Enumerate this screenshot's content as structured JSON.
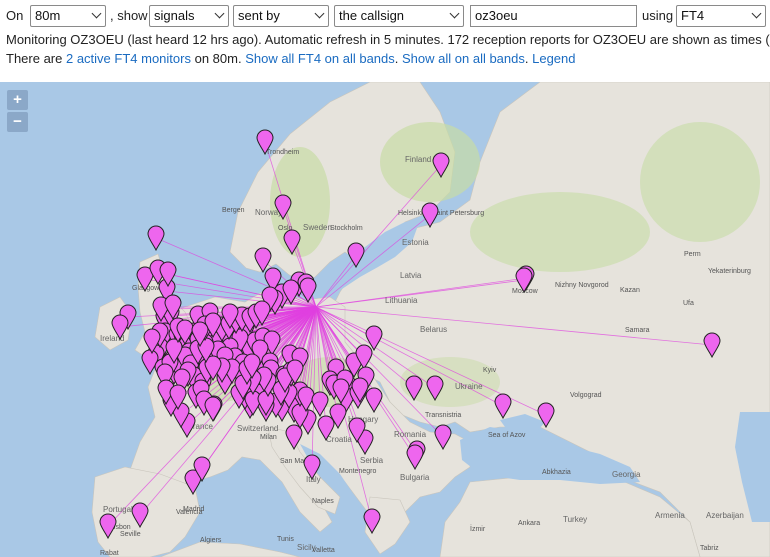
{
  "controls": {
    "on_label": "On",
    "band": "80m",
    "show_label": ", show",
    "show": "signals",
    "direction": "sent by",
    "target": "the callsign",
    "callsign": "oz3oeu",
    "using_label": "using",
    "mode": "FT4"
  },
  "info": {
    "line1": "Monitoring OZ3OEU (last heard 12 hrs ago). Automatic refresh in 5 minutes. 172 reception reports for OZ3OEU are shown as times (",
    "line2_pre": "There are ",
    "active_monitors_link": "2 active FT4 monitors",
    "line2_mid": " on 80m. ",
    "show_all_ft4_link": "Show all FT4 on all bands",
    "dot1": ". ",
    "show_all_link": "Show all on all bands",
    "dot2": ". ",
    "legend_link": "Legend"
  },
  "map": {
    "zoom_in": "+",
    "zoom_out": "−",
    "cities": {
      "trondheim": "Trondheim",
      "finland": "Finland",
      "bergen": "Bergen",
      "norway": "Norway",
      "helsinki": "Helsinki",
      "saint_petersburg": "Saint Petersburg",
      "oslo": "Oslo",
      "sweden": "Sweden",
      "stockholm": "Stockholm",
      "estonia": "Estonia",
      "perm": "Perm",
      "latvia": "Latvia",
      "yekaterinburg": "Yekaterinburg",
      "nizhny": "Nizhny Novgorod",
      "kazan": "Kazan",
      "moscow": "Moscow",
      "lithuania": "Lithuania",
      "ufa": "Ufa",
      "glasgow": "Glasgow",
      "belarus": "Belarus",
      "samara": "Samara",
      "ireland": "Ireland",
      "kyiv": "Kyiv",
      "ukraine": "Ukraine",
      "volgograd": "Volgograd",
      "transnistria": "Transnistria",
      "sea_of_azov": "Sea of Azov",
      "france": "France",
      "switzerland": "Switzerland",
      "milan": "Milan",
      "hungary": "Hungary",
      "croatia": "Croatia",
      "romania": "Romania",
      "san_marino": "San Marino",
      "serbia": "Serbia",
      "abkhazia": "Abkhazia",
      "georgia": "Georgia",
      "montenegro": "Montenegro",
      "bulgaria": "Bulgaria",
      "italy": "Italy",
      "naples": "Naples",
      "portugal": "Portugal",
      "madrid": "Madrid",
      "lisbon": "Lisbon",
      "valencia": "Valencia",
      "ankara": "Ankara",
      "turkey": "Turkey",
      "seville": "Seville",
      "izmir": "İzmir",
      "armenia": "Armenia",
      "azerbaijan": "Azerbaijan",
      "tabriz": "Tabriz",
      "algiers": "Algiers",
      "tunis": "Tunis",
      "sicily": "Sicily",
      "valletta": "Valletta",
      "rabat": "Rabat"
    },
    "marker_count_caption": "172"
  },
  "colors": {
    "marker": "#ee66ee",
    "marker_stroke": "#222222",
    "path": "#e040e0",
    "land": "#e6e3dc",
    "water": "#a9c8e6",
    "forest": "#c7dca5",
    "link": "#1a6bc1"
  },
  "icons": {
    "marker": "map-pin-icon",
    "dropdown": "chevron-down-icon"
  }
}
